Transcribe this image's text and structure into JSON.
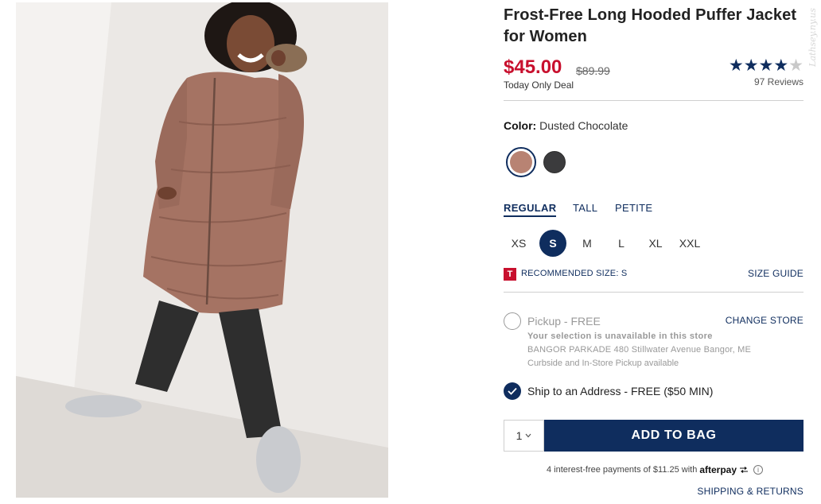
{
  "product": {
    "title": "Frost-Free Long Hooded Puffer Jacket for Women",
    "price": "$45.00",
    "original_price": "$89.99",
    "deal_label": "Today Only Deal",
    "rating": {
      "stars": 4,
      "max_stars": 5,
      "reviews_label": "97 Reviews"
    },
    "watermark": "Lathsey.ny.us"
  },
  "color": {
    "label": "Color:",
    "selected_name": "Dusted Chocolate",
    "swatches": [
      {
        "name": "Dusted Chocolate",
        "hex": "#b88373",
        "selected": true
      },
      {
        "name": "Black",
        "hex": "#3b3b3d",
        "selected": false
      }
    ]
  },
  "fit_tabs": [
    {
      "label": "REGULAR",
      "active": true
    },
    {
      "label": "TALL",
      "active": false
    },
    {
      "label": "PETITE",
      "active": false
    }
  ],
  "sizes": [
    {
      "label": "XS",
      "selected": false
    },
    {
      "label": "S",
      "selected": true
    },
    {
      "label": "M",
      "selected": false
    },
    {
      "label": "L",
      "selected": false
    },
    {
      "label": "XL",
      "selected": false
    },
    {
      "label": "XXL",
      "selected": false
    }
  ],
  "recommendation": {
    "badge": "T",
    "text": "RECOMMENDED SIZE: S",
    "size_guide": "SIZE GUIDE"
  },
  "fulfillment": {
    "pickup_label": "Pickup - FREE",
    "change_store": "CHANGE STORE",
    "unavailable": "Your selection is unavailable in this store",
    "store_address": "BANGOR PARKADE 480 Stillwater Avenue  Bangor, ME",
    "curbside": "Curbside and In-Store Pickup available",
    "ship_label": "Ship to an Address - FREE ($50 MIN)"
  },
  "purchase": {
    "quantity": "1",
    "add_to_bag": "ADD TO BAG",
    "afterpay_text": "4 interest-free payments of $11.25 with",
    "afterpay_brand": "afterpay",
    "info_glyph": "i",
    "shipping_returns": "SHIPPING & RETURNS"
  },
  "colors": {
    "accent_navy": "#0f2d5e",
    "sale_red": "#c8102e"
  }
}
